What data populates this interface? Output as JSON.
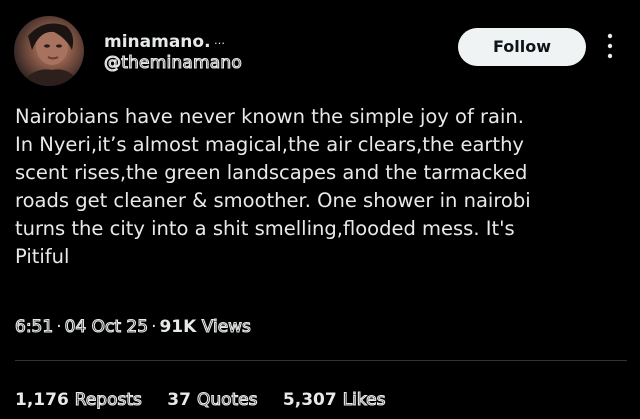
{
  "author": {
    "display_name": "minamano.",
    "name_decoration": "…",
    "handle": "@theminamano"
  },
  "follow_label": "Follow",
  "more_icon": "more-vertical-icon",
  "tweet": {
    "text": "Nairobians have never known the simple joy of rain.\nIn Nyeri,it’s almost magical,the air clears,the earthy\nscent rises,the green landscapes and the tarmacked\nroads get cleaner & smoother. One shower in nairobi\nturns the city into a shit smelling,flooded mess. It's\nPitiful"
  },
  "meta": {
    "time": "6:51",
    "separator": "·",
    "date": "04 Oct 25",
    "views_count": "91K",
    "views_label": "Views"
  },
  "stats": {
    "reposts_count": "1,176",
    "reposts_label": "Reposts",
    "quotes_count": "37",
    "quotes_label": "Quotes",
    "likes_count": "5,307",
    "likes_label": "Likes"
  },
  "colors": {
    "background": "#000000",
    "text": "#e7e9ea",
    "follow_button_bg": "#eff3f4",
    "follow_button_text": "#0f1419",
    "divider": "#2f3336"
  }
}
